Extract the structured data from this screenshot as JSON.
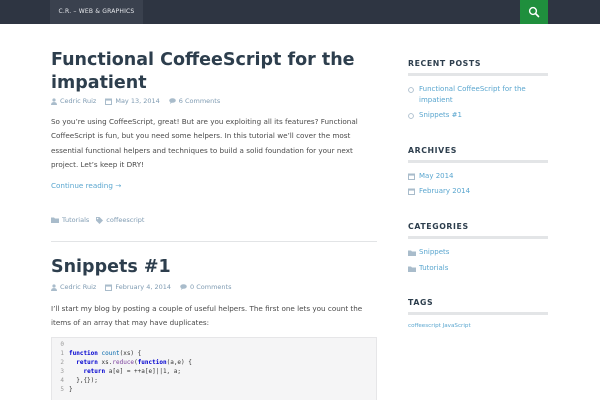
{
  "header": {
    "brand": "C.R. – WEB & GRAPHICS",
    "search_icon": "search-icon",
    "colors": {
      "bar": "#2e3542",
      "search": "#1f8f3d"
    }
  },
  "posts": [
    {
      "title": "Functional CoffeeScript for the impatient",
      "author": "Cedric Ruiz",
      "date": "May 13, 2014",
      "comments": "6 Comments",
      "excerpt": "So you’re using CoffeeScript, great! But are you exploiting all its features? Functional CoffeeScript is fun, but you need some helpers. In this tutorial we’ll cover the most essential functional helpers and techniques to build a solid foundation for your next project. Let’s keep it DRY!",
      "more": "Continue reading →",
      "category": "Tutorials",
      "tag": "coffeescript"
    },
    {
      "title": "Snippets #1",
      "author": "Cedric Ruiz",
      "date": "February 4, 2014",
      "comments": "0 Comments",
      "excerpt": "I’ll start my blog by posting a couple of useful helpers. The first one lets you count the items of an array that may have duplicates:",
      "code_line_numbers": [
        "0",
        "1",
        "2",
        "3",
        "4",
        "5"
      ]
    }
  ],
  "sidebar": {
    "recent_posts": {
      "heading": "RECENT POSTS",
      "items": [
        "Functional CoffeeScript for the impatient",
        "Snippets #1"
      ]
    },
    "archives": {
      "heading": "ARCHIVES",
      "items": [
        "May 2014",
        "February 2014"
      ]
    },
    "categories": {
      "heading": "CATEGORIES",
      "items": [
        "Snippets",
        "Tutorials"
      ]
    },
    "tags": {
      "heading": "TAGS",
      "cloud": "coffeescript JavaScript"
    }
  }
}
